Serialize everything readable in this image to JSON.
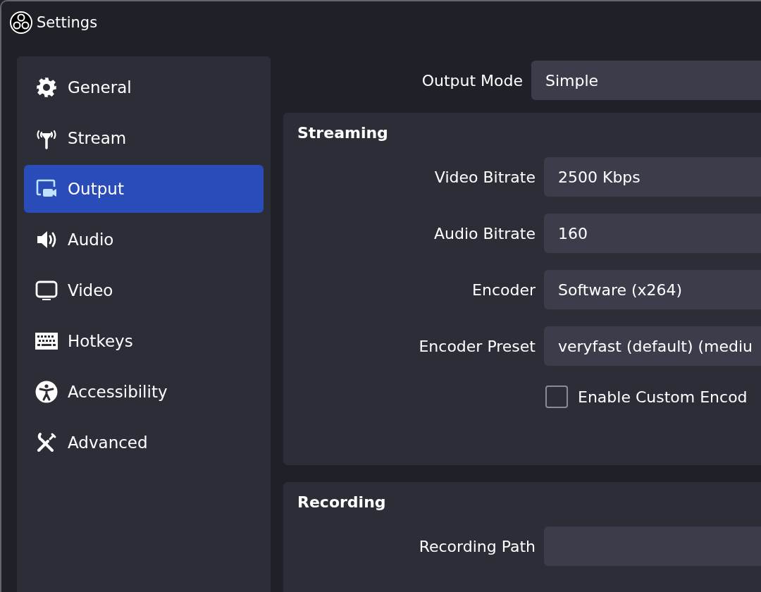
{
  "window": {
    "title": "Settings"
  },
  "sidebar": {
    "items": [
      {
        "label": "General",
        "selected": false
      },
      {
        "label": "Stream",
        "selected": false
      },
      {
        "label": "Output",
        "selected": true
      },
      {
        "label": "Audio",
        "selected": false
      },
      {
        "label": "Video",
        "selected": false
      },
      {
        "label": "Hotkeys",
        "selected": false
      },
      {
        "label": "Accessibility",
        "selected": false
      },
      {
        "label": "Advanced",
        "selected": false
      }
    ]
  },
  "output_mode": {
    "label": "Output Mode",
    "value": "Simple"
  },
  "streaming": {
    "title": "Streaming",
    "fields": [
      {
        "label": "Video Bitrate",
        "value": "2500 Kbps"
      },
      {
        "label": "Audio Bitrate",
        "value": "160"
      },
      {
        "label": "Encoder",
        "value": "Software (x264)"
      },
      {
        "label": "Encoder Preset",
        "value": "veryfast (default) (mediu"
      }
    ],
    "checkbox": {
      "label": "Enable Custom Encod",
      "checked": false
    }
  },
  "recording": {
    "title": "Recording",
    "fields": [
      {
        "label": "Recording Path"
      }
    ]
  }
}
